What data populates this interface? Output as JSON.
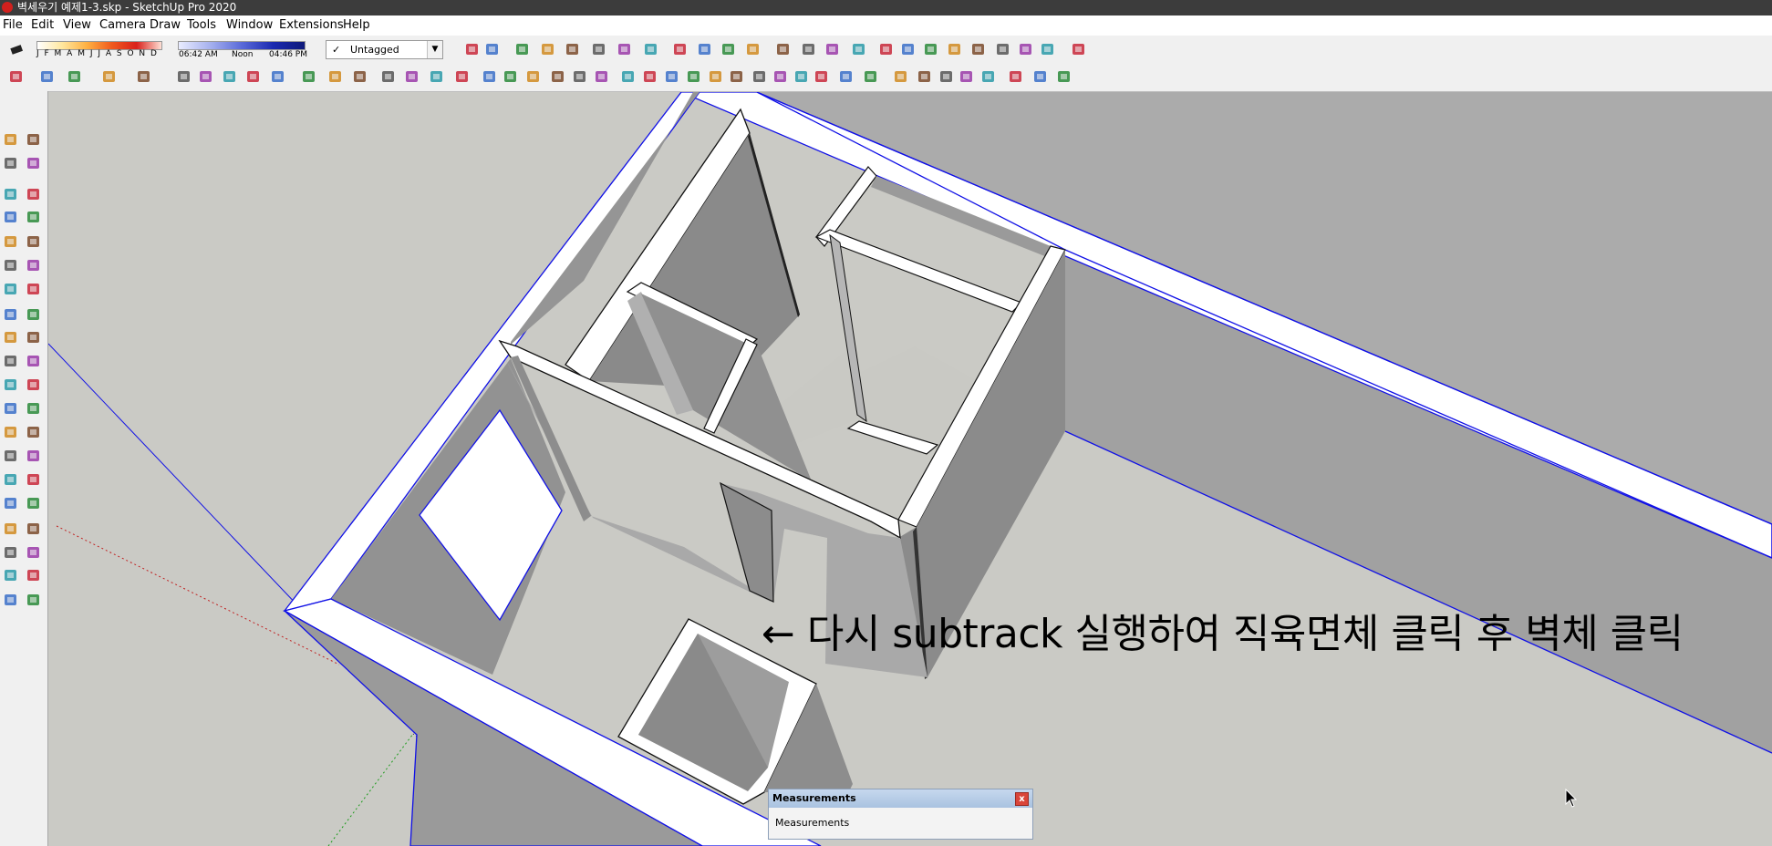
{
  "window": {
    "title": "벽세우기 예제1-3.skp - SketchUp Pro 2020"
  },
  "menu": [
    "File",
    "Edit",
    "View",
    "Camera",
    "Draw",
    "Tools",
    "Window",
    "Extensions",
    "Help"
  ],
  "shadow": {
    "months": "J F M A M J J A S O N D",
    "time_start": "06:42 AM",
    "time_mid": "Noon",
    "time_end": "04:46 PM"
  },
  "tags": {
    "check": "✓",
    "current": "Untagged",
    "dropdown_icon": "chevron-down-icon"
  },
  "annotation": "← 다시 subtrack 실행하여 직육면체 클릭 후 벽체 클릭",
  "measurements": {
    "title": "Measurements",
    "label": "Measurements",
    "close": "x"
  },
  "colors": {
    "title_bg": "#3c3c3c",
    "toolbar_bg": "#f0f0f0",
    "viewport_bg": "#cacac5",
    "selection": "#1010e6",
    "wall_top": "#ffffff",
    "wall_light": "#a7a7a7",
    "wall_dark": "#7d7d7d"
  },
  "toolbar_top": [
    "eraser-icon",
    "shadows-icon",
    "x-ray-icon",
    "back-edges-icon",
    "wireframe-icon",
    "hidden-line-icon",
    "shaded-icon",
    "shaded-textures-icon",
    "monochrome-icon",
    "sandbox-from-contours-icon",
    "sandbox-from-scratch-icon",
    "smoove-icon",
    "stamp-icon",
    "drape-icon",
    "add-detail-icon",
    "flip-edge-icon",
    "orbit-icon",
    "pan-icon",
    "zoom-icon",
    "zoom-window-icon",
    "zoom-extents-icon",
    "position-camera-icon",
    "look-around-icon",
    "walk-icon",
    "geo-location-icon"
  ],
  "toolbar_second": [
    "select-icon",
    "eraser-icon",
    "pencil-icon",
    "arc-icon",
    "rectangle-icon",
    "push-pull-icon",
    "follow-me-icon",
    "move-icon",
    "rotate-icon",
    "scale-icon",
    "tape-measure-icon",
    "text-icon",
    "paint-bucket-icon",
    "orbit-icon",
    "pan-icon",
    "zoom-icon",
    "zoom-extents-icon",
    "warehouse-icon",
    "extension-warehouse-icon",
    "layout-icon",
    "model-info-icon",
    "advanced-camera-icon",
    "iso-view-icon",
    "top-view-icon",
    "front-view-icon",
    "right-view-icon",
    "back-view-icon",
    "left-view-icon",
    "section-plane-icon",
    "display-section-planes-icon",
    "display-section-cuts-icon",
    "display-section-fill-icon",
    "outer-shell-icon",
    "intersect-icon",
    "union-icon",
    "subtract-icon",
    "trim-icon",
    "split-icon",
    "solid-inspector-icon",
    "axes-icon",
    "front-view-icon",
    "top-view-icon",
    "iso-view-icon"
  ],
  "toolbar_left": [
    "select-icon",
    "make-component-icon",
    "paint-bucket-icon",
    "eraser-icon",
    "line-icon",
    "freehand-icon",
    "rectangle-icon",
    "rotated-rectangle-icon",
    "circle-icon",
    "polygon-icon",
    "arc-icon",
    "pie-icon",
    "two-point-arc-icon",
    "three-point-arc-icon",
    "move-icon",
    "push-pull-icon",
    "rotate-icon",
    "follow-me-icon",
    "scale-icon",
    "offset-icon",
    "tape-measure-icon",
    "dimension-icon",
    "protractor-icon",
    "text-icon",
    "axes-icon",
    "3d-text-icon",
    "orbit-icon",
    "pan-icon",
    "zoom-icon",
    "zoom-window-icon",
    "zoom-extents-icon",
    "previous-view-icon",
    "position-camera-icon",
    "look-around-icon",
    "walk-icon",
    "section-plane-icon",
    "warehouse-icon",
    "extension-warehouse-icon",
    "send-to-layout-icon",
    "extension-manager-icon"
  ]
}
